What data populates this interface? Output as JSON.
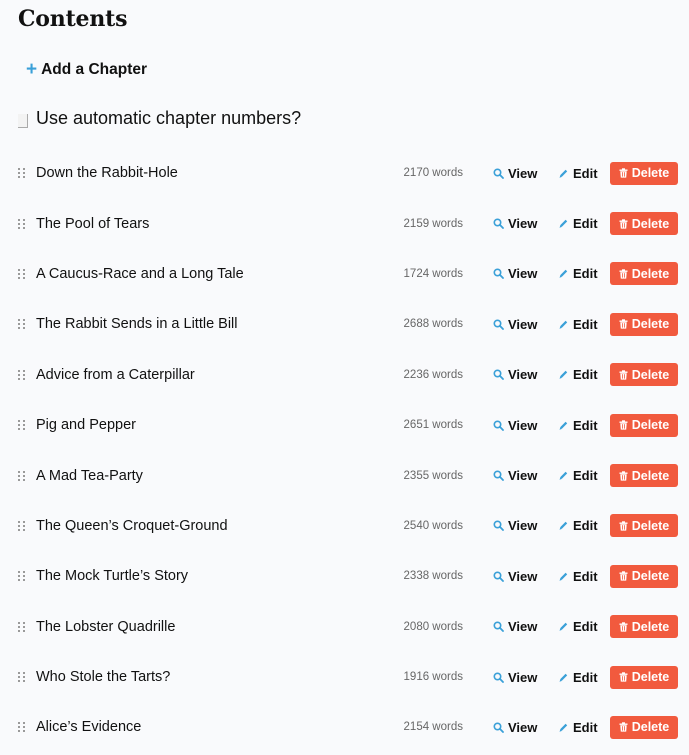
{
  "page": {
    "title": "Contents",
    "add_chapter_label": "Add a Chapter",
    "auto_numbers_label": "Use automatic chapter numbers?"
  },
  "actions": {
    "view_label": "View",
    "edit_label": "Edit",
    "delete_label": "Delete"
  },
  "colors": {
    "accent": "#3aa0d8",
    "delete": "#f15a3e"
  },
  "chapters": [
    {
      "title": "Down the Rabbit-Hole",
      "words": "2170 words"
    },
    {
      "title": "The Pool of Tears",
      "words": "2159 words"
    },
    {
      "title": "A Caucus-Race and a Long Tale",
      "words": "1724 words"
    },
    {
      "title": "The Rabbit Sends in a Little Bill",
      "words": "2688 words"
    },
    {
      "title": "Advice from a Caterpillar",
      "words": "2236 words"
    },
    {
      "title": "Pig and Pepper",
      "words": "2651 words"
    },
    {
      "title": "A Mad Tea-Party",
      "words": "2355 words"
    },
    {
      "title": "The Queen’s Croquet-Ground",
      "words": "2540 words"
    },
    {
      "title": "The Mock Turtle’s Story",
      "words": "2338 words"
    },
    {
      "title": "The Lobster Quadrille",
      "words": "2080 words"
    },
    {
      "title": "Who Stole the Tarts?",
      "words": "1916 words"
    },
    {
      "title": "Alice’s Evidence",
      "words": "2154 words"
    }
  ]
}
